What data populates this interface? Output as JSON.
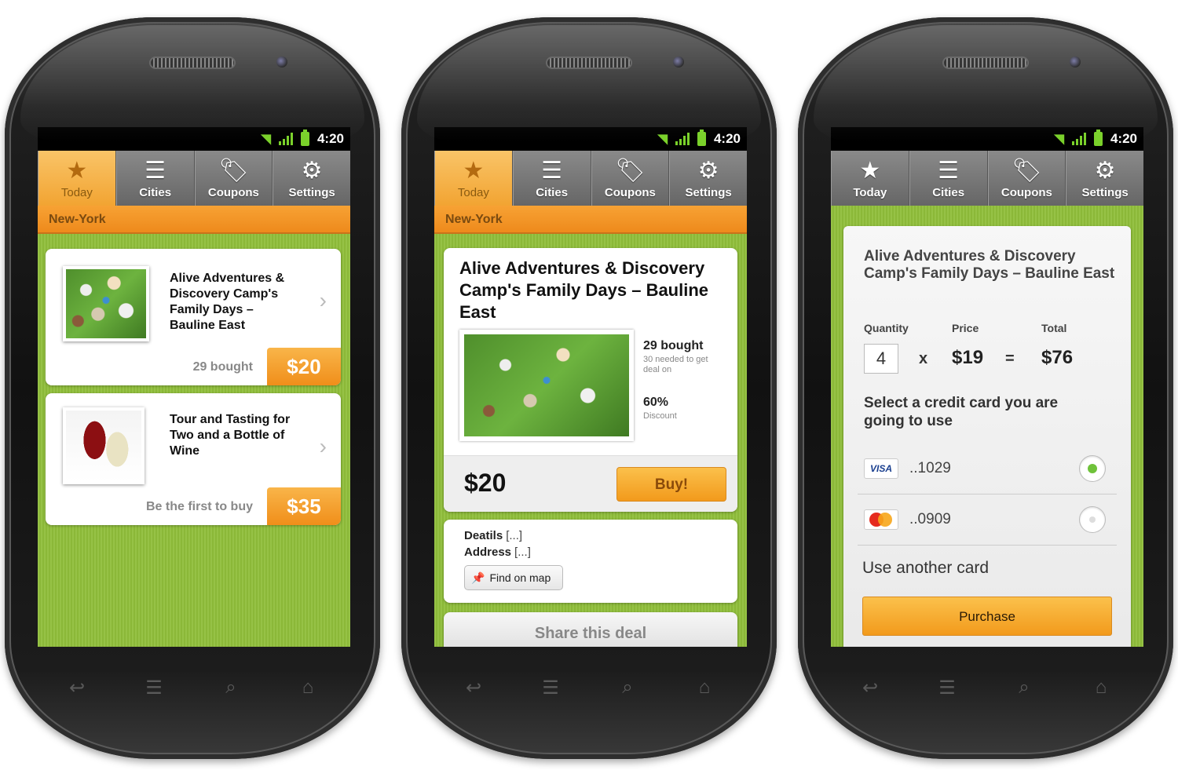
{
  "status": {
    "time": "4:20"
  },
  "tabs": [
    {
      "label": "Today",
      "icon": "star-icon",
      "glyph": "★"
    },
    {
      "label": "Cities",
      "icon": "list-icon",
      "glyph": "☰"
    },
    {
      "label": "Coupons",
      "icon": "tags-icon",
      "glyph": "🏷"
    },
    {
      "label": "Settings",
      "icon": "gear-icon",
      "glyph": "⚙"
    }
  ],
  "city": "New-York",
  "deals": [
    {
      "title": "Alive Adventures & Discovery Camp's Family Days – Bauline East",
      "status": "29 bought",
      "price": "$20"
    },
    {
      "title": "Tour and Tasting for Two and a Bottle of Wine",
      "status": "Be the first to buy",
      "price": "$35"
    }
  ],
  "detail": {
    "title": "Alive Adventures & Discovery Camp's Family Days – Bauline East",
    "bought": "29 bought",
    "needed": "30 needed to get deal on",
    "discount": "60%",
    "discount_label": "Discount",
    "price": "$20",
    "buy_label": "Buy!",
    "details_label": "Deatils",
    "details_value": "[...]",
    "address_label": "Address",
    "address_value": "[...]",
    "map_label": "Find on map",
    "share_label": "Share this deal"
  },
  "checkout": {
    "title": "Alive Adventures & Discovery Camp's Family Days –  Bauline East",
    "quantity_label": "Quantity",
    "price_label": "Price",
    "total_label": "Total",
    "quantity": "4",
    "times": "x",
    "price": "$19",
    "equals": "=",
    "total": "$76",
    "select_label": "Select a credit card you are going to use",
    "cards": [
      {
        "brand": "VISA",
        "number": "..1029",
        "selected": true
      },
      {
        "brand": "MasterCard",
        "number": "..0909",
        "selected": false
      }
    ],
    "another_label": "Use another card",
    "purchase_label": "Purchase"
  },
  "colors": {
    "green": "#8fbe3a",
    "orange": "#f08e1a",
    "tab_gray": "#777777"
  }
}
